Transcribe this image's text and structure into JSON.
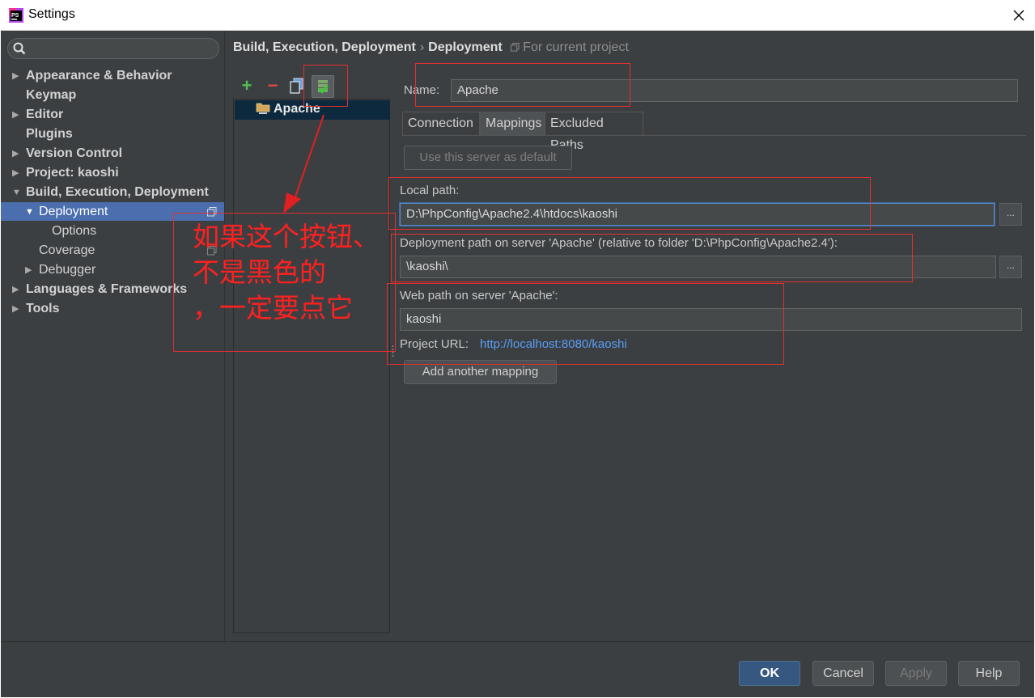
{
  "window": {
    "title": "Settings"
  },
  "search": {
    "placeholder": ""
  },
  "tree": {
    "items": [
      {
        "label": "Appearance & Behavior",
        "arrow": "▶"
      },
      {
        "label": "Keymap"
      },
      {
        "label": "Editor",
        "arrow": "▶"
      },
      {
        "label": "Plugins"
      },
      {
        "label": "Version Control",
        "arrow": "▶"
      },
      {
        "label": "Project: kaoshi",
        "arrow": "▶"
      },
      {
        "label": "Build, Execution, Deployment",
        "arrow": "▼"
      },
      {
        "label": "Deployment",
        "arrow": "▼"
      },
      {
        "label": "Options"
      },
      {
        "label": "Coverage"
      },
      {
        "label": "Debugger",
        "arrow": "▶"
      },
      {
        "label": "Languages & Frameworks",
        "arrow": "▶"
      },
      {
        "label": "Tools",
        "arrow": "▶"
      }
    ]
  },
  "breadcrumb": {
    "parent": "Build, Execution, Deployment",
    "separator": "›",
    "current": "Deployment",
    "scope": "For current project"
  },
  "toolbar": {
    "add": "+",
    "remove": "−"
  },
  "servers": [
    {
      "name": "Apache"
    }
  ],
  "form": {
    "name_label": "Name:",
    "name_value": "Apache",
    "tabs": [
      "Connection",
      "Mappings",
      "Excluded Paths"
    ],
    "active_tab": "Mappings",
    "default_button": "Use this server as default",
    "local_path_label": "Local path:",
    "local_path_value": "D:\\PhpConfig\\Apache2.4\\htdocs\\kaoshi",
    "deploy_path_label": "Deployment path on server 'Apache' (relative to folder 'D:\\PhpConfig\\Apache2.4'):",
    "deploy_path_value": "\\kaoshi\\",
    "web_path_label": "Web path on server 'Apache':",
    "web_path_value": "kaoshi",
    "project_url_label": "Project URL:",
    "project_url_value": "http://localhost:8080/kaoshi",
    "add_mapping_button": "Add another mapping",
    "browse": "..."
  },
  "annotation": {
    "line1": "如果这个按钮、",
    "line2": "不是黑色的",
    "line3": "，一定要点它"
  },
  "dialog_buttons": {
    "ok": "OK",
    "cancel": "Cancel",
    "apply": "Apply",
    "help": "Help"
  },
  "colors": {
    "background": "#3c3f41",
    "selection": "#4b6eaf",
    "link": "#589df6",
    "annotation": "#ff2020",
    "primary_button": "#365880"
  }
}
